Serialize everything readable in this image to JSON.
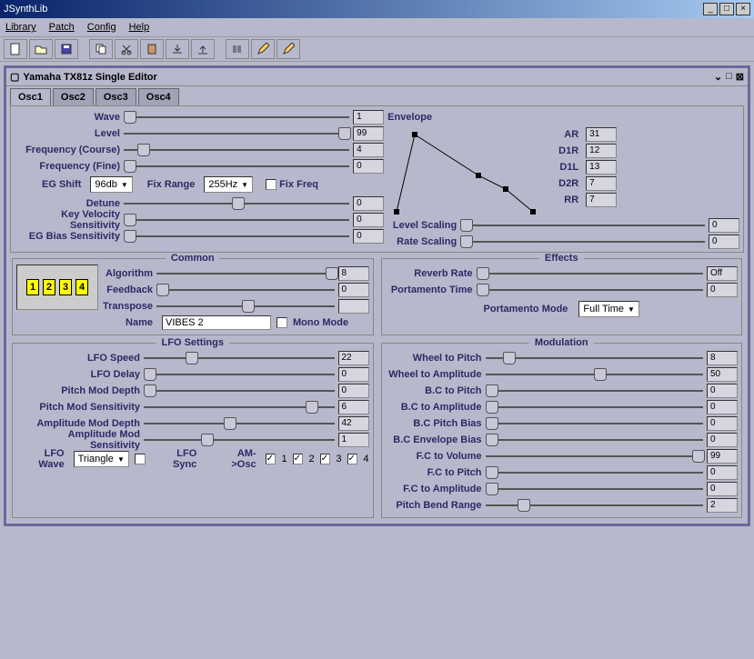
{
  "window": {
    "title": "JSynthLib"
  },
  "menu": {
    "library": "Library",
    "patch": "Patch",
    "config": "Config",
    "help": "Help"
  },
  "inner": {
    "title": "Yamaha TX81z Single Editor"
  },
  "tabs": [
    "Osc1",
    "Osc2",
    "Osc3",
    "Osc4"
  ],
  "osc": {
    "wave_lbl": "Wave",
    "wave_val": "1",
    "level_lbl": "Level",
    "level_val": "99",
    "freqc_lbl": "Frequency (Course)",
    "freqc_val": "4",
    "freqf_lbl": "Frequency (Fine)",
    "freqf_val": "0",
    "egshift_lbl": "EG Shift",
    "egshift_val": "96db",
    "fixrange_lbl": "Fix Range",
    "fixrange_val": "255Hz",
    "fixfreq_lbl": "Fix Freq",
    "detune_lbl": "Detune",
    "detune_val": "0",
    "kvs_lbl": "Key Velocity Sensitivity",
    "kvs_val": "0",
    "egbs_lbl": "EG Bias Sensitivity",
    "egbs_val": "0"
  },
  "env": {
    "title": "Envelope",
    "ar_lbl": "AR",
    "ar_val": "31",
    "d1r_lbl": "D1R",
    "d1r_val": "12",
    "d1l_lbl": "D1L",
    "d1l_val": "13",
    "d2r_lbl": "D2R",
    "d2r_val": "7",
    "rr_lbl": "RR",
    "rr_val": "7",
    "lvlscale_lbl": "Level Scaling",
    "lvlscale_val": "0",
    "ratescale_lbl": "Rate Scaling",
    "ratescale_val": "0"
  },
  "common": {
    "title": "Common",
    "algo_lbl": "Algorithm",
    "algo_val": "8",
    "feedback_lbl": "Feedback",
    "feedback_val": "0",
    "transpose_lbl": "Transpose",
    "transpose_val": "",
    "name_lbl": "Name",
    "name_val": "VIBES 2",
    "mono_lbl": "Mono Mode"
  },
  "effects": {
    "title": "Effects",
    "reverb_lbl": "Reverb Rate",
    "reverb_val": "Off",
    "porta_lbl": "Portamento Time",
    "porta_val": "0",
    "pmode_lbl": "Portamento Mode",
    "pmode_val": "Full Time"
  },
  "lfo": {
    "title": "LFO Settings",
    "speed_lbl": "LFO Speed",
    "speed_val": "22",
    "delay_lbl": "LFO Delay",
    "delay_val": "0",
    "pmd_lbl": "Pitch Mod Depth",
    "pmd_val": "0",
    "pms_lbl": "Pitch Mod Sensitivity",
    "pms_val": "6",
    "amd_lbl": "Amplitude Mod Depth",
    "amd_val": "42",
    "ams_lbl": "Amplitude Mod Sensitivity",
    "ams_val": "1",
    "wave_lbl": "LFO Wave",
    "wave_val": "Triangle",
    "sync_lbl": "LFO Sync",
    "amosc_lbl": "AM->Osc",
    "am1": "1",
    "am2": "2",
    "am3": "3",
    "am4": "4"
  },
  "mod": {
    "title": "Modulation",
    "wp_lbl": "Wheel to Pitch",
    "wp_val": "8",
    "wa_lbl": "Wheel to Amplitude",
    "wa_val": "50",
    "bcp_lbl": "B.C to Pitch",
    "bcp_val": "0",
    "bca_lbl": "B.C to Amplitude",
    "bca_val": "0",
    "bcpb_lbl": "B.C Pitch Bias",
    "bcpb_val": "0",
    "bceb_lbl": "B.C Envelope Bias",
    "bceb_val": "0",
    "fcv_lbl": "F.C to Volume",
    "fcv_val": "99",
    "fcp_lbl": "F.C to Pitch",
    "fcp_val": "0",
    "fca_lbl": "F.C to Amplitude",
    "fca_val": "0",
    "pbr_lbl": "Pitch Bend Range",
    "pbr_val": "2"
  }
}
